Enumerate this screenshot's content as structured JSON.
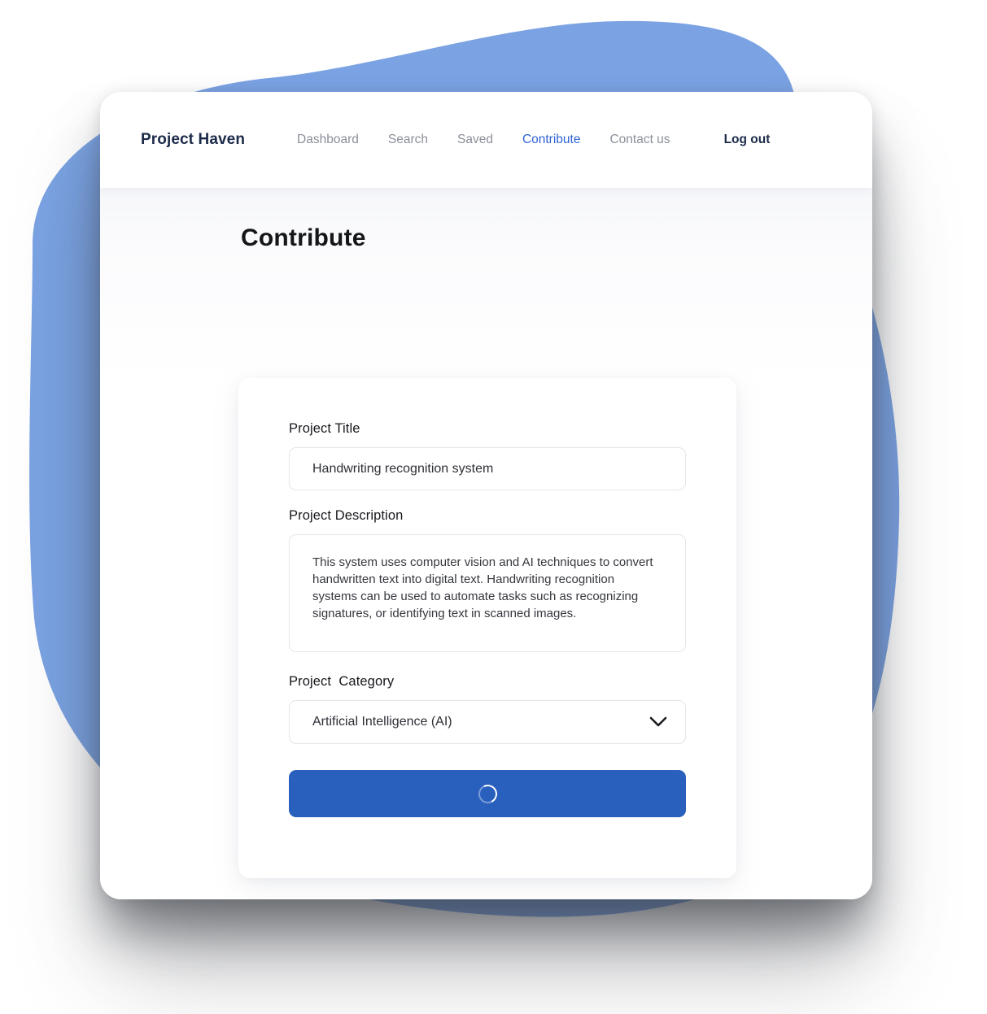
{
  "window": {
    "background_color": "#ffffff",
    "blob_color": "#7ba3e3",
    "card_background": "#f8f9fb"
  },
  "navbar": {
    "brand": "Project Haven",
    "links": [
      {
        "label": "Dashboard",
        "active": false
      },
      {
        "label": "Search",
        "active": false
      },
      {
        "label": "Saved",
        "active": false
      },
      {
        "label": "Contribute",
        "active": true
      },
      {
        "label": "Contact us",
        "active": false
      }
    ],
    "logout_label": "Log out",
    "active_color": "#2f63d6",
    "inactive_color": "#8b8f99",
    "brand_color": "#1b2a49"
  },
  "page": {
    "title": "Contribute"
  },
  "form": {
    "title_field": {
      "label": "Project Title",
      "value": "Handwriting recognition system",
      "placeholder": "Project Title"
    },
    "description_field": {
      "label": "Project Description",
      "value": "This system uses computer vision and AI techniques to convert handwritten text into digital text. Handwriting recognition systems can be used to automate tasks such as recognizing signatures, or identifying text in scanned images.",
      "placeholder": "Project Description"
    },
    "category_field": {
      "label": "Project  Category",
      "value": "Artificial Intelligence (AI)",
      "chevron_icon": "chevron-down-icon"
    },
    "submit_button": {
      "label": "",
      "state": "loading",
      "spinner_icon": "loading-spinner-icon",
      "color": "#2a60bd"
    }
  }
}
